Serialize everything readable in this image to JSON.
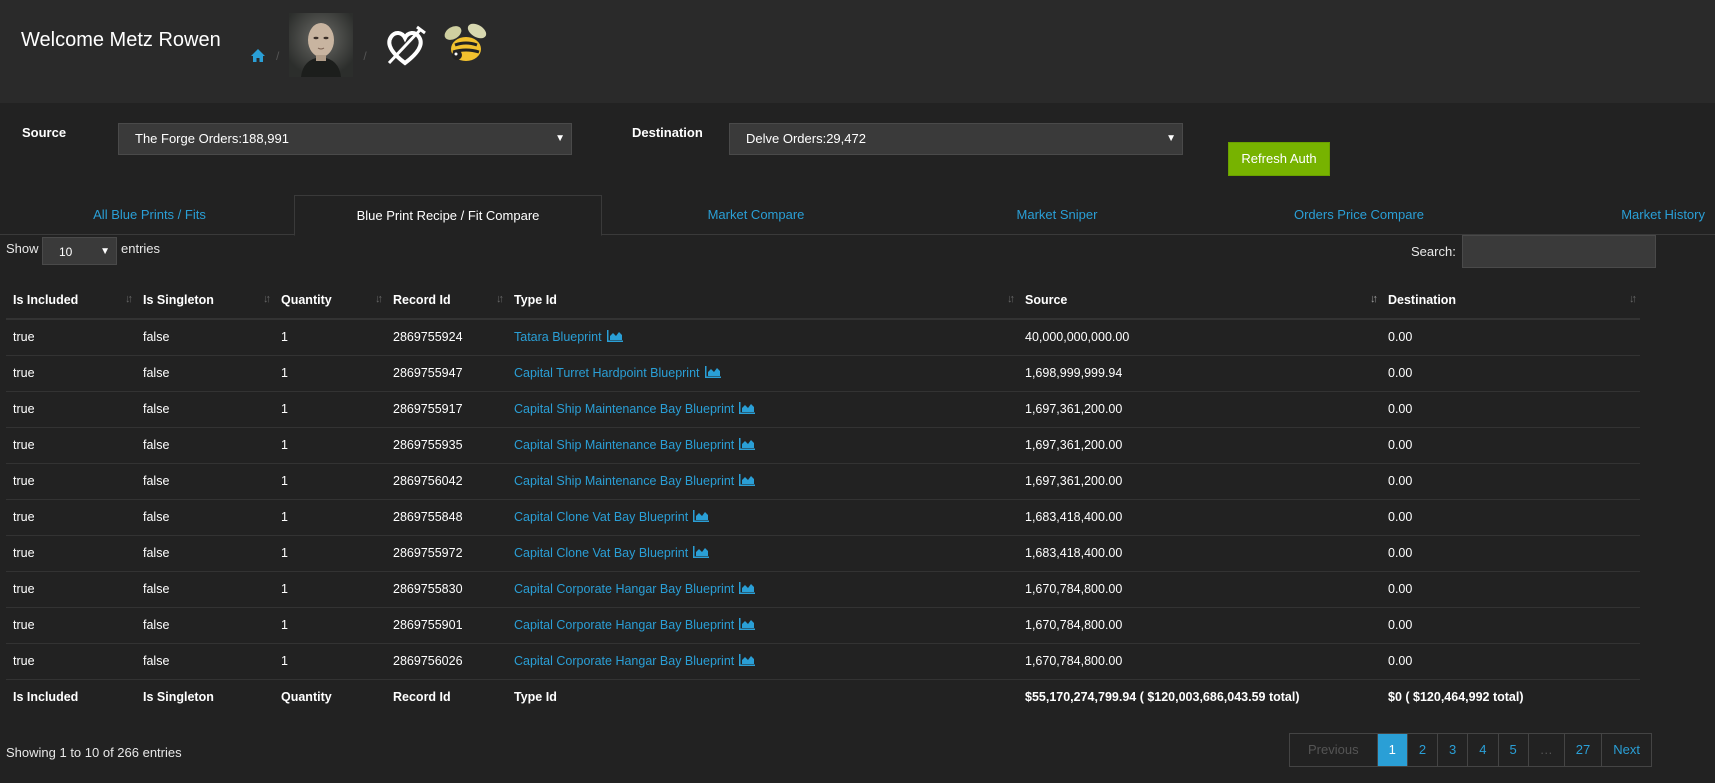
{
  "header": {
    "welcome": "Welcome Metz Rowen",
    "icons": [
      "home-icon",
      "character-portrait",
      "alliance-logo",
      "corporation-logo"
    ]
  },
  "source": {
    "label": "Source",
    "value": "The Forge Orders:188,991"
  },
  "destination": {
    "label": "Destination",
    "value": "Delve Orders:29,472"
  },
  "refresh_label": "Refresh Auth",
  "tabs": [
    {
      "label": "All Blue Prints / Fits"
    },
    {
      "label": "Blue Print Recipe / Fit Compare",
      "active": true
    },
    {
      "label": "Market Compare"
    },
    {
      "label": "Market Sniper"
    },
    {
      "label": "Orders Price Compare"
    },
    {
      "label": "Market History"
    }
  ],
  "controls": {
    "show": "Show",
    "length": "10",
    "entries": "entries",
    "search": "Search:"
  },
  "columns": [
    "Is Included",
    "Is Singleton",
    "Quantity",
    "Record Id",
    "Type Id",
    "Source",
    "Destination"
  ],
  "rows": [
    [
      "true",
      "false",
      "1",
      "2869755924",
      "Tatara Blueprint",
      "40,000,000,000.00",
      "0.00"
    ],
    [
      "true",
      "false",
      "1",
      "2869755947",
      "Capital Turret Hardpoint Blueprint",
      "1,698,999,999.94",
      "0.00"
    ],
    [
      "true",
      "false",
      "1",
      "2869755917",
      "Capital Ship Maintenance Bay Blueprint",
      "1,697,361,200.00",
      "0.00"
    ],
    [
      "true",
      "false",
      "1",
      "2869755935",
      "Capital Ship Maintenance Bay Blueprint",
      "1,697,361,200.00",
      "0.00"
    ],
    [
      "true",
      "false",
      "1",
      "2869756042",
      "Capital Ship Maintenance Bay Blueprint",
      "1,697,361,200.00",
      "0.00"
    ],
    [
      "true",
      "false",
      "1",
      "2869755848",
      "Capital Clone Vat Bay Blueprint",
      "1,683,418,400.00",
      "0.00"
    ],
    [
      "true",
      "false",
      "1",
      "2869755972",
      "Capital Clone Vat Bay Blueprint",
      "1,683,418,400.00",
      "0.00"
    ],
    [
      "true",
      "false",
      "1",
      "2869755830",
      "Capital Corporate Hangar Bay Blueprint",
      "1,670,784,800.00",
      "0.00"
    ],
    [
      "true",
      "false",
      "1",
      "2869755901",
      "Capital Corporate Hangar Bay Blueprint",
      "1,670,784,800.00",
      "0.00"
    ],
    [
      "true",
      "false",
      "1",
      "2869756026",
      "Capital Corporate Hangar Bay Blueprint",
      "1,670,784,800.00",
      "0.00"
    ]
  ],
  "footer_row": [
    "Is Included",
    "Is Singleton",
    "Quantity",
    "Record Id",
    "Type Id",
    "$55,170,274,799.94 ( $120,003,686,043.59 total)",
    "$0 ( $120,464,992 total)"
  ],
  "info": "Showing 1 to 10 of 266 entries",
  "pagination": [
    "Previous",
    "1",
    "2",
    "3",
    "4",
    "5",
    "…",
    "27",
    "Next"
  ],
  "colors": {
    "accent": "#2a9fd6",
    "success": "#77b300",
    "background": "#222222"
  }
}
